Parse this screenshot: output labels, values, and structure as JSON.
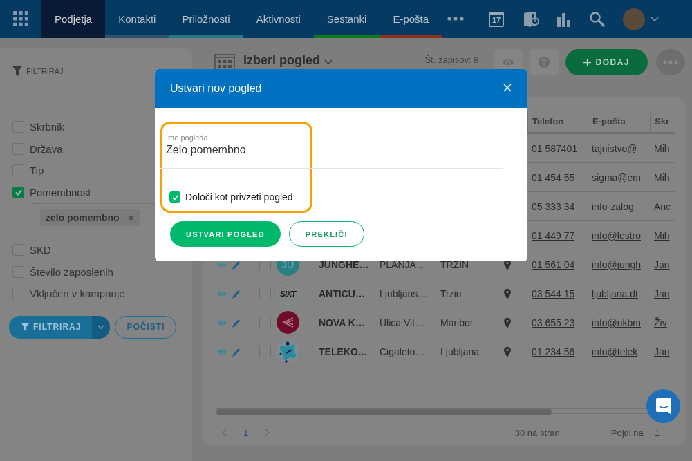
{
  "nav": {
    "tabs": [
      {
        "label": "Podjetja",
        "selected": true
      },
      {
        "label": "Kontakti",
        "selected": false,
        "color": "#2b5272"
      },
      {
        "label": "Priložnosti",
        "selected": false,
        "color": "#1f7a85"
      },
      {
        "label": "Aktivnosti",
        "selected": false
      },
      {
        "label": "Sestanki",
        "selected": false,
        "color": "#0b7a1f"
      },
      {
        "label": "E-pošta",
        "selected": false,
        "color": "#8e3020"
      }
    ],
    "calendar_day": "17"
  },
  "sidebar": {
    "title": "FILTRIRAJ",
    "filters": [
      {
        "label": "Skrbnik",
        "checked": false
      },
      {
        "label": "Država",
        "checked": false
      },
      {
        "label": "Tip",
        "checked": false
      },
      {
        "label": "Pomembnost",
        "checked": true,
        "tags": [
          "zelo pomembno"
        ]
      },
      {
        "label": "SKD",
        "checked": false
      },
      {
        "label": "Število zaposlenih",
        "checked": false
      },
      {
        "label": "Vključen v kampanje",
        "checked": false
      }
    ],
    "filter_button": "FILTRIRAJ",
    "clear_button": "POČISTI"
  },
  "toolbar": {
    "view_title": "Izberi pogled",
    "record_count": "Št. zapisov: 8",
    "add_button": "DODAJ"
  },
  "table": {
    "columns": [
      "Telefon",
      "E-pošta",
      "Skr"
    ],
    "rows": [
      {
        "phone": "01 587401",
        "email": "tajnistvo@",
        "owner": "Mih"
      },
      {
        "phone": "01 454 55",
        "email": "sigma@em",
        "owner": "Mih"
      },
      {
        "phone": "05 333 34",
        "email": "info-zalog",
        "owner": "Anc"
      },
      {
        "phone": "01 449 77",
        "email": "info@lestro",
        "owner": "Mih"
      },
      {
        "checked": false,
        "logo": {
          "kind": "initials",
          "text": "JU"
        },
        "name": "JUNGHE…",
        "address": "PLANJA…",
        "city": "TRZIN",
        "phone": "01 561 04",
        "email": "info@jungh",
        "owner": "Jan"
      },
      {
        "checked": false,
        "logo": {
          "kind": "wordmark",
          "text": "SIXT"
        },
        "name": "ANTICU…",
        "address": "Ljubljans…",
        "city": "Trzin",
        "phone": "03 544 15",
        "email": "ljubljana.dt",
        "owner": "Jan"
      },
      {
        "checked": false,
        "logo": {
          "kind": "chevron"
        },
        "name": "NOVA K…",
        "address": "Ulica Vit…",
        "city": "Maribor",
        "phone": "03 655 23",
        "email": "info@nkbm",
        "owner": "Živ"
      },
      {
        "checked": false,
        "logo": {
          "kind": "dots"
        },
        "name": "TELEKO…",
        "address": "Cigaleto…",
        "city": "Ljubljana",
        "phone": "01 234 56",
        "email": "info@telek",
        "owner": "Jan"
      }
    ]
  },
  "pagination": {
    "page": "1",
    "per_page": "30 na stran",
    "goto_label": "Pojdi na",
    "goto_value": "1"
  },
  "modal": {
    "title": "Ustvari nov pogled",
    "field_label": "Ime pogleda",
    "field_value": "Zelo pomembno",
    "default_label": "Določi kot privzeti pogled",
    "default_checked": true,
    "create_button": "USTVARI POGLED",
    "cancel_button": "PREKLIČI"
  }
}
